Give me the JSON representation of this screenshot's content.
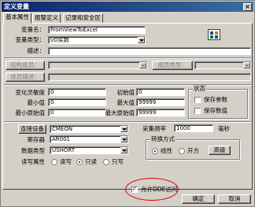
{
  "window": {
    "title": "定义变量",
    "close_label": "×"
  },
  "tabs": [
    "基本属性",
    "报警定义",
    "记录和安全区"
  ],
  "basic": {
    "var_name_label": "变量名：",
    "var_name_value": "FromViewToExcel",
    "var_type_label": "变量类型：",
    "var_type_value": "I/O实数",
    "desc_label": "描述：",
    "desc_value": "",
    "struct_member_label": "结构成员：",
    "member_desc_label": "成员描述：",
    "member_type_label": "成员类型："
  },
  "numeric": {
    "sensitivity_label": "变化灵敏度",
    "sensitivity_value": "0",
    "min_label": "最小值",
    "min_value": "0",
    "min_raw_label": "最小原始值",
    "min_raw_value": "0",
    "init_label": "初始值",
    "init_value": "0",
    "max_label": "最大值",
    "max_value": "99999",
    "max_raw_label": "最大原始值",
    "max_raw_value": "99999"
  },
  "state": {
    "title": "状态",
    "save_params_label": "保存参数",
    "save_params_checked": false,
    "save_value_label": "保存数值",
    "save_value_checked": false
  },
  "io": {
    "device_button": "连接设备",
    "device_value": "CMEON",
    "register_label": "寄存器",
    "register_value": "AR001",
    "data_type_label": "数据类型",
    "data_type_value": "USHORT",
    "rw_label": "读写属性",
    "rw_options": [
      "读写",
      "只读",
      "只写"
    ],
    "rw_selected": "只读",
    "sample_label": "采集频率",
    "sample_value": "1000",
    "sample_unit": "毫秒"
  },
  "convert": {
    "title": "转换方式",
    "options": [
      "线性",
      "开方"
    ],
    "selected": "线性",
    "advanced_button": "高级"
  },
  "dde": {
    "label": "允许DDE访问",
    "checked": true
  },
  "footer": {
    "ok": "确定",
    "cancel": "取消"
  },
  "colors": {
    "title_bar": "#0a246a",
    "annotation": "#e00000",
    "face": "#d4d0c8"
  }
}
